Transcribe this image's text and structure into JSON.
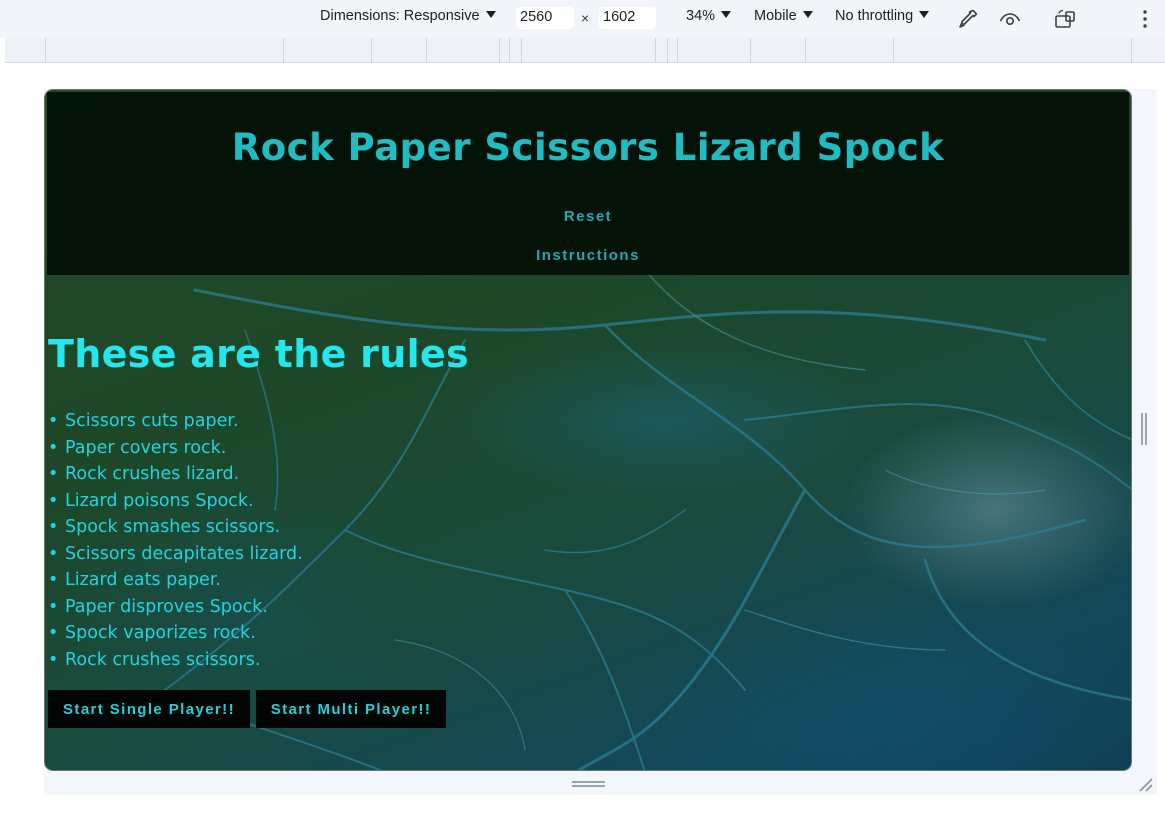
{
  "devtools": {
    "dimensions_label": "Dimensions: Responsive",
    "width_value": "2560",
    "times_symbol": "×",
    "height_value": "1602",
    "zoom_label": "34%",
    "device_label": "Mobile",
    "throttling_label": "No throttling",
    "icons": [
      "eyedropper-icon",
      "eye-icon",
      "rotate-device-icon",
      "more-vert-icon"
    ]
  },
  "page": {
    "title": "Rock Paper Scissors Lizard Spock",
    "nav": {
      "reset": "Reset",
      "instructions": "Instructions"
    },
    "rules_heading": "These are the rules",
    "bullet": "•",
    "rules": [
      "Scissors cuts paper.",
      "Paper covers rock.",
      "Rock crushes lizard.",
      "Lizard poisons Spock.",
      "Spock smashes scissors.",
      "Scissors decapitates lizard.",
      "Lizard eats paper.",
      "Paper disproves Spock.",
      "Spock vaporizes rock.",
      "Rock crushes scissors."
    ],
    "buttons": {
      "single": "Start Single Player!!",
      "multi": "Start Multi Player!!"
    }
  },
  "colors": {
    "title": "#1fbcc4",
    "rules_text": "#22d4e0",
    "header_bg": "#020e04"
  }
}
